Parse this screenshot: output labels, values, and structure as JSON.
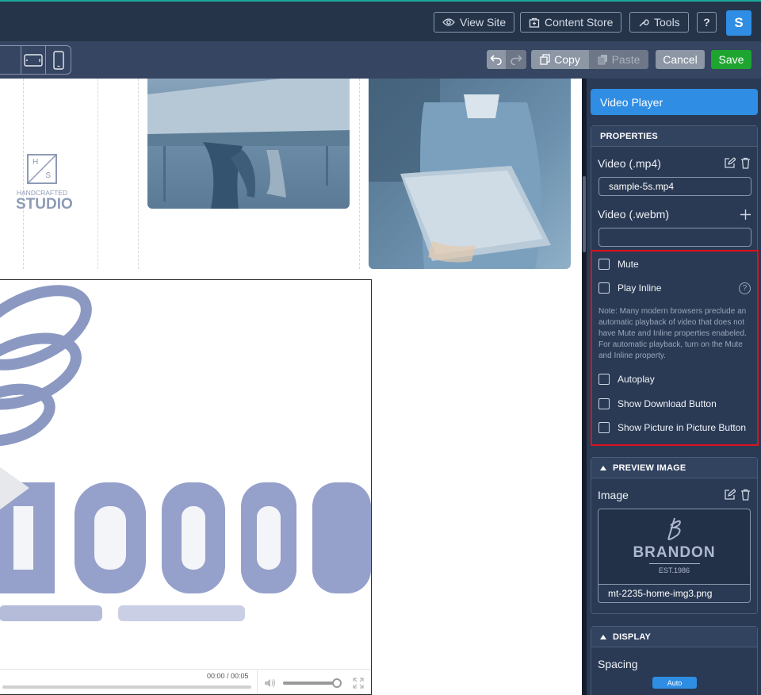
{
  "topbar": {
    "view_site": "View Site",
    "content_store": "Content Store",
    "tools": "Tools",
    "help": "?",
    "avatar": "S"
  },
  "toolbar": {
    "copy": "Copy",
    "paste": "Paste",
    "cancel": "Cancel",
    "save": "Save"
  },
  "canvas": {
    "logo_top": "H",
    "logo_bottom": "S",
    "logo_line1": "HANDCRAFTED",
    "logo_line2": "STUDIO",
    "video_time": "00:00 / 00:05",
    "volume": 0.95
  },
  "panel": {
    "title": "Video Player",
    "properties": {
      "header": "PROPERTIES",
      "mp4_label": "Video (.mp4)",
      "mp4_value": "sample-5s.mp4",
      "webm_label": "Video (.webm)",
      "webm_value": "",
      "checkboxes": [
        "Mute",
        "Play Inline",
        "Autoplay",
        "Show Download Button",
        "Show Picture in Picture Button"
      ],
      "note": "Note: Many modern browsers preclude an automatic playback of video that does not have Mute and Inline properties enabeled. For automatic playback, turn on the Mute and Inline property."
    },
    "preview": {
      "header": "PREVIEW IMAGE",
      "image_label": "Image",
      "brand": "BRANDON",
      "est": "EST.1986",
      "filename": "mt-2235-home-img3.png"
    },
    "display": {
      "header": "DISPLAY",
      "spacing_label": "Spacing",
      "spacing_value": "Auto"
    }
  },
  "colors": {
    "topbar": "#263449",
    "toolbar": "#354562",
    "panel": "#2a3a54",
    "accent": "#2f8de4",
    "save": "#1ea52f",
    "highlight": "#e0101a"
  }
}
